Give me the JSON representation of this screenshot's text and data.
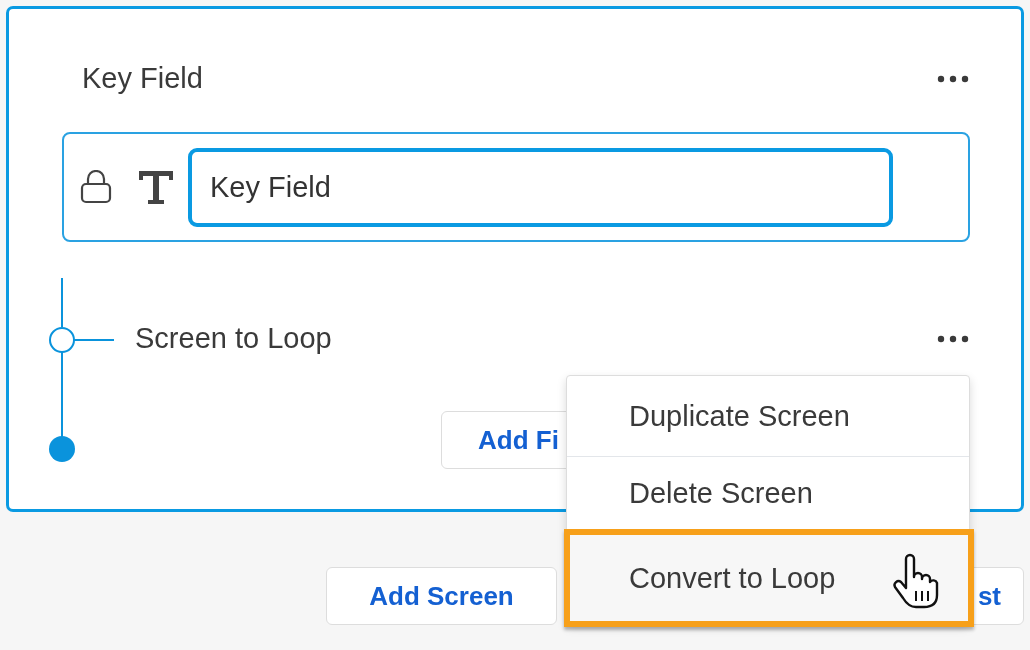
{
  "screen_card": {
    "title": "Key Field",
    "field": {
      "value": "Key Field",
      "locked": true
    },
    "loop_screen": {
      "title": "Screen to Loop"
    },
    "add_field_button": "Add Fi"
  },
  "footer_buttons": [
    {
      "label": "Add Screen",
      "kind": "full"
    },
    {
      "label": "st",
      "kind": "partial"
    }
  ],
  "context_menu": {
    "items": [
      {
        "label": "Duplicate Screen",
        "selected": false
      },
      {
        "label": "Delete Screen",
        "selected": false
      },
      {
        "label": "Convert to Loop",
        "selected": true
      }
    ]
  }
}
